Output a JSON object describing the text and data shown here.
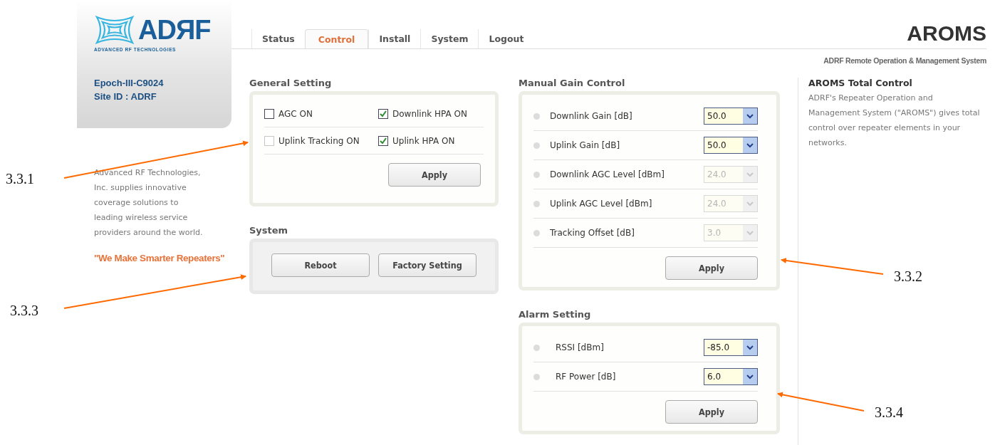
{
  "logo": {
    "wordmark": "ADЯF",
    "tagline": "ADVANCED RF TECHNOLOGIES"
  },
  "tabs": [
    {
      "label": "Status",
      "selected": false
    },
    {
      "label": "Control",
      "selected": true
    },
    {
      "label": "Install",
      "selected": false
    },
    {
      "label": "System",
      "selected": false
    },
    {
      "label": "Logout",
      "selected": false
    }
  ],
  "brand": {
    "title": "AROMS",
    "subtitle": "ADRF Remote Operation & Management System"
  },
  "device": {
    "model": "Epoch-III-C9024",
    "site": "Site ID : ADRF"
  },
  "sidebar": {
    "about": "Advanced RF Technologies, Inc. supplies innovative coverage solutions to leading wireless service providers around the world.",
    "slogan": "\"We Make Smarter Repeaters\""
  },
  "general_setting": {
    "title": "General Setting",
    "checkboxes": [
      {
        "label": "AGC ON",
        "checked": false,
        "disabled": false
      },
      {
        "label": "Downlink HPA ON",
        "checked": true,
        "disabled": false
      },
      {
        "label": "Uplink Tracking ON",
        "checked": false,
        "disabled": true
      },
      {
        "label": "Uplink HPA ON",
        "checked": true,
        "disabled": false
      }
    ],
    "button": "Apply"
  },
  "system": {
    "title": "System",
    "buttons": [
      "Reboot",
      "Factory Setting"
    ]
  },
  "manual_gain_control": {
    "title": "Manual Gain Control",
    "rows": [
      {
        "label": "Downlink Gain [dB]",
        "value": "50.0",
        "disabled": false
      },
      {
        "label": "Uplink Gain [dB]",
        "value": "50.0",
        "disabled": false
      },
      {
        "label": "Downlink AGC Level [dBm]",
        "value": "24.0",
        "disabled": true
      },
      {
        "label": "Uplink AGC Level [dBm]",
        "value": "24.0",
        "disabled": true
      },
      {
        "label": "Tracking Offset [dB]",
        "value": "3.0",
        "disabled": true
      }
    ],
    "button": "Apply"
  },
  "alarm_setting": {
    "title": "Alarm Setting",
    "rows": [
      {
        "label": "RSSI [dBm]",
        "value": "-85.0",
        "disabled": false
      },
      {
        "label": "RF Power [dB]",
        "value": "6.0",
        "disabled": false
      }
    ],
    "button": "Apply"
  },
  "info": {
    "title": "AROMS Total Control",
    "text": "ADRF's Repeater Operation and Management System (\"AROMS\") gives total control over repeater elements in your networks."
  },
  "callouts": [
    {
      "label": "3.3.1"
    },
    {
      "label": "3.3.2"
    },
    {
      "label": "3.3.3"
    },
    {
      "label": "3.3.4"
    }
  ]
}
